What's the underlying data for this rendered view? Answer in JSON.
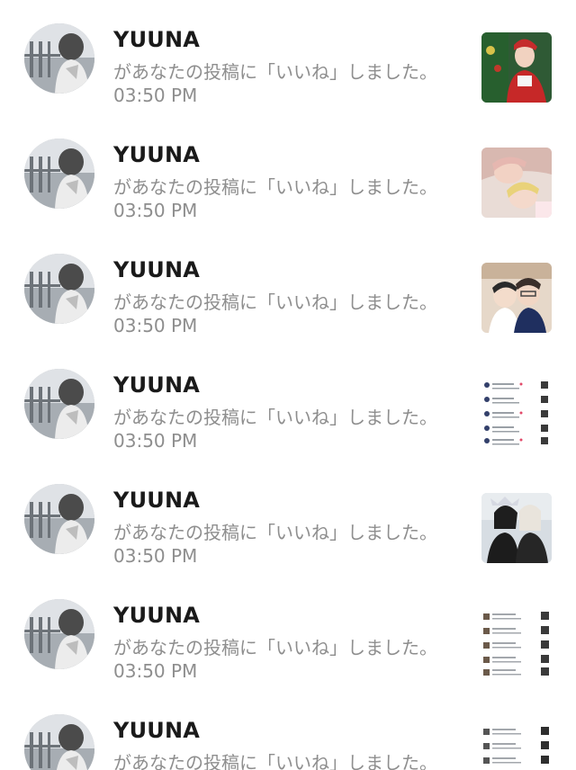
{
  "notifications": [
    {
      "username": "YUUNA",
      "message": "があなたの投稿に「いいね」しました。",
      "time": "03:50 PM",
      "thumb_icon": "photo-thumbnail"
    },
    {
      "username": "YUUNA",
      "message": "があなたの投稿に「いいね」しました。",
      "time": "03:50 PM",
      "thumb_icon": "photo-thumbnail"
    },
    {
      "username": "YUUNA",
      "message": "があなたの投稿に「いいね」しました。",
      "time": "03:50 PM",
      "thumb_icon": "photo-thumbnail"
    },
    {
      "username": "YUUNA",
      "message": "があなたの投稿に「いいね」しました。",
      "time": "03:50 PM",
      "thumb_icon": "screenshot-thumbnail"
    },
    {
      "username": "YUUNA",
      "message": "があなたの投稿に「いいね」しました。",
      "time": "03:50 PM",
      "thumb_icon": "photo-thumbnail"
    },
    {
      "username": "YUUNA",
      "message": "があなたの投稿に「いいね」しました。",
      "time": "03:50 PM",
      "thumb_icon": "screenshot-thumbnail"
    },
    {
      "username": "YUUNA",
      "message": "があなたの投稿に「いいね」しました。",
      "time": "",
      "thumb_icon": "screenshot-thumbnail"
    }
  ]
}
